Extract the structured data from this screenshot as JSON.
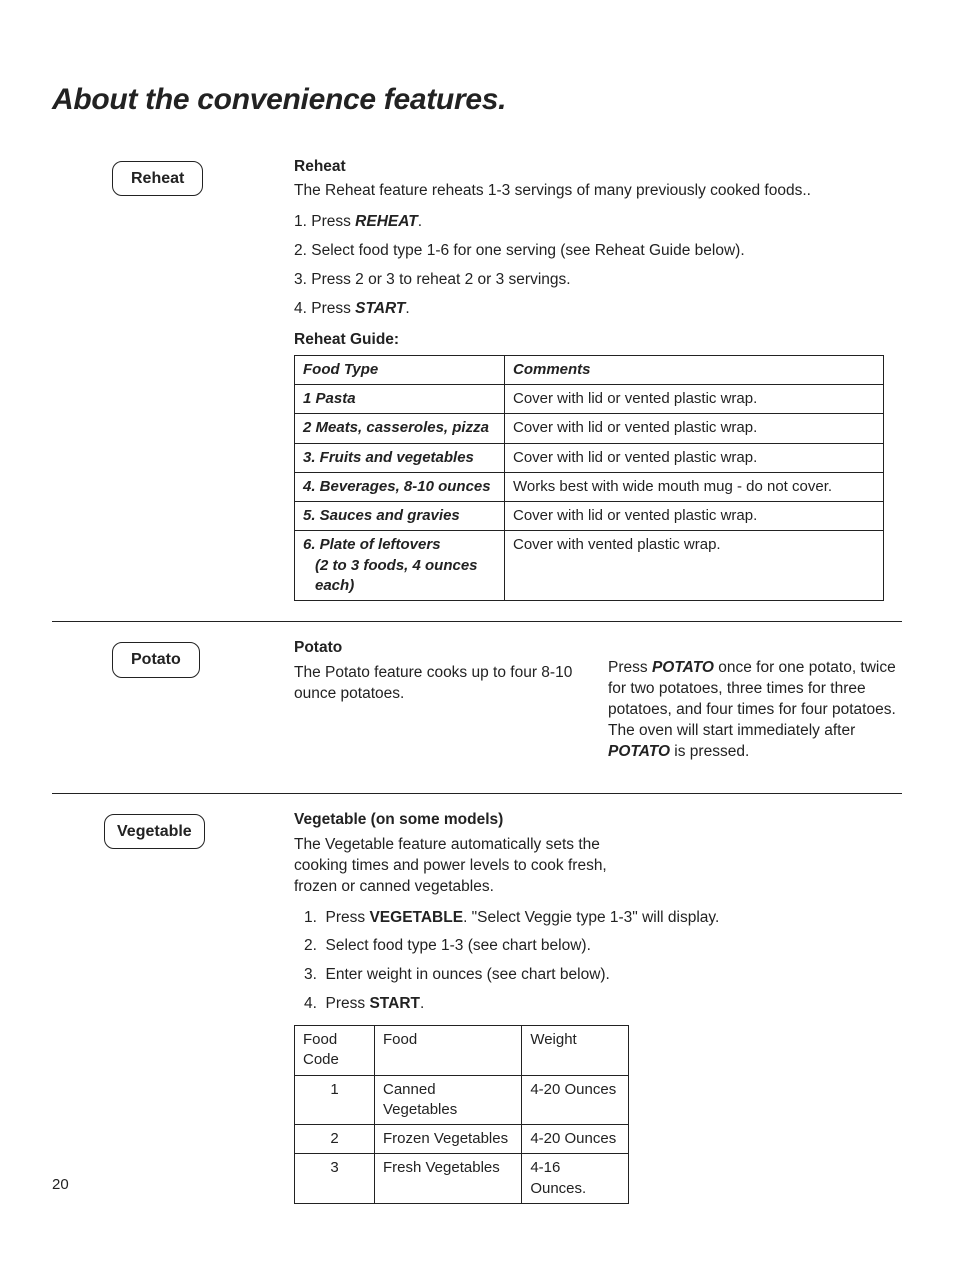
{
  "page_title": "About the convenience features.",
  "page_number": "20",
  "reheat": {
    "pill": "Reheat",
    "heading": "Reheat",
    "intro": "The Reheat feature reheats 1-3 servings of many previously cooked foods..",
    "steps": [
      {
        "n": "1.",
        "pre": "Press ",
        "bold": "REHEAT",
        "post": "."
      },
      {
        "n": "2.",
        "pre": "Select food type 1-6 for one serving (see Reheat Guide below).",
        "bold": "",
        "post": ""
      },
      {
        "n": "3.",
        "pre": "Press 2 or 3 to reheat 2 or 3 servings.",
        "bold": "",
        "post": ""
      },
      {
        "n": "4.",
        "pre": "Press ",
        "bold": "START",
        "post": "."
      }
    ],
    "guide_label": "Reheat Guide:",
    "table": {
      "headers": [
        "Food Type",
        "Comments"
      ],
      "rows": [
        {
          "ft": "1 Pasta",
          "sub": "",
          "c": "Cover with lid or vented plastic wrap."
        },
        {
          "ft": "2 Meats, casseroles, pizza",
          "sub": "",
          "c": "Cover with lid or vented plastic wrap."
        },
        {
          "ft": "3. Fruits and vegetables",
          "sub": "",
          "c": "Cover with lid or vented plastic wrap."
        },
        {
          "ft": "4. Beverages, 8-10 ounces",
          "sub": "",
          "c": "Works best with wide mouth mug - do not cover."
        },
        {
          "ft": "5. Sauces and gravies",
          "sub": "",
          "c": "Cover with lid or vented plastic wrap."
        },
        {
          "ft": "6. Plate of leftovers",
          "sub": "(2 to 3 foods, 4 ounces each)",
          "c": "Cover with vented plastic wrap."
        }
      ]
    }
  },
  "potato": {
    "pill": "Potato",
    "heading": "Potato",
    "col1": "The Potato feature cooks up to four 8-10 ounce potatoes.",
    "col2_pre": "Press ",
    "col2_b1": "POTATO",
    "col2_mid": " once for one potato, twice for two potatoes, three times for three potatoes, and four times for four potatoes. The oven will start immediately after ",
    "col2_b2": "POTATO",
    "col2_post": " is pressed."
  },
  "vegetable": {
    "pill": "Vegetable",
    "heading": "Vegetable (on some models)",
    "intro": "The Vegetable feature automatically sets the cooking times and power levels to cook fresh, frozen or canned vegetables.",
    "steps": [
      {
        "n": "1.",
        "pre": "Press ",
        "bold": "VEGETABLE",
        "post": ". \"Select Veggie type 1-3\" will display."
      },
      {
        "n": "2.",
        "pre": "Select food type 1-3 (see chart below).",
        "bold": "",
        "post": ""
      },
      {
        "n": "3.",
        "pre": "Enter weight in ounces (see chart below).",
        "bold": "",
        "post": ""
      },
      {
        "n": "4.",
        "pre": "Press ",
        "bold": "START",
        "post": "."
      }
    ],
    "table": {
      "headers": [
        "Food Code",
        "Food",
        "Weight"
      ],
      "rows": [
        {
          "code": "1",
          "food": "Canned Vegetables",
          "w": "4-20 Ounces"
        },
        {
          "code": "2",
          "food": "Frozen Vegetables",
          "w": "4-20 Ounces"
        },
        {
          "code": "3",
          "food": "Fresh Vegetables",
          "w": "4-16 Ounces."
        }
      ]
    }
  }
}
